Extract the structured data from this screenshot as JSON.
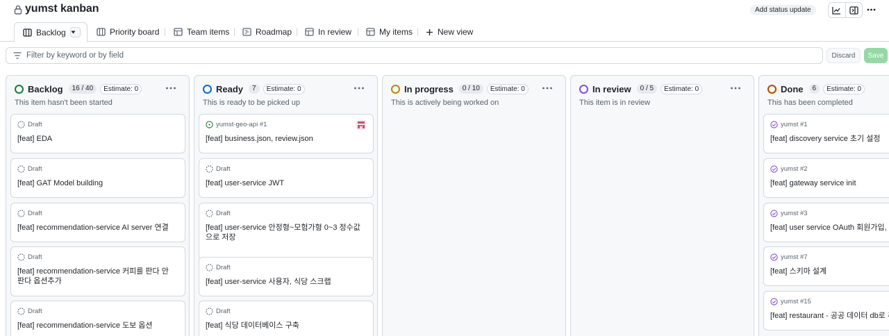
{
  "project": {
    "title": "yumst kanban",
    "status_button": "Add status update"
  },
  "tabs": [
    {
      "label": "Backlog",
      "icon": "board-icon"
    },
    {
      "label": "Priority board",
      "icon": "board-icon"
    },
    {
      "label": "Team items",
      "icon": "table-icon"
    },
    {
      "label": "Roadmap",
      "icon": "roadmap-icon"
    },
    {
      "label": "In review",
      "icon": "table-icon"
    },
    {
      "label": "My items",
      "icon": "table-icon"
    },
    {
      "label": "New view",
      "icon": "plus-icon"
    }
  ],
  "filter": {
    "placeholder": "Filter by keyword or by field",
    "discard": "Discard",
    "save": "Save"
  },
  "colors": {
    "backlog": "#1a7f37",
    "ready": "#0969da",
    "in_progress": "#bf8700",
    "in_review": "#8250df",
    "done": "#bc4c00",
    "done_item": "#8250df",
    "open_item": "#1a7f37"
  },
  "columns": [
    {
      "name": "Backlog",
      "count": "16 / 40",
      "estimate": "Estimate: 0",
      "description": "This item hasn't been started",
      "cards": [
        {
          "meta": "Draft",
          "title": "[feat] EDA"
        },
        {
          "meta": "Draft",
          "title": "[feat] GAT Model building"
        },
        {
          "meta": "Draft",
          "title": "[feat] recommendation-service AI server 연결"
        },
        {
          "meta": "Draft",
          "title": "[feat] recommendation-service 커피를 판다 안판다 옵션추가"
        },
        {
          "meta": "Draft",
          "title": "[feat] recommendation-service 도보 옵션"
        }
      ]
    },
    {
      "name": "Ready",
      "count": "7",
      "estimate": "Estimate: 0",
      "description": "This is ready to be picked up",
      "cards": [
        {
          "meta": "yumst-geo-api #1",
          "title": "[feat] business.json, review.json"
        },
        {
          "meta": "Draft",
          "title": "[feat] user-service JWT"
        },
        {
          "meta": "Draft",
          "title": "[feat] user-service 안정형~모험가형 0~3 정수값으로 저장"
        },
        {
          "meta": "Draft",
          "title": "[feat] user-service 사용자, 식당 스크랩"
        },
        {
          "meta": "Draft",
          "title": "[feat] 식당 데이터베이스 구축"
        }
      ]
    },
    {
      "name": "In progress",
      "count": "0 / 10",
      "estimate": "Estimate: 0",
      "description": "This is actively being worked on",
      "cards": []
    },
    {
      "name": "In review",
      "count": "0 / 5",
      "estimate": "Estimate: 0",
      "description": "This item is in review",
      "cards": []
    },
    {
      "name": "Done",
      "count": "6",
      "estimate": "Estimate: 0",
      "description": "This has been completed",
      "cards": [
        {
          "meta": "yumst #1",
          "title": "[feat] discovery service 초기 설정"
        },
        {
          "meta": "yumst #2",
          "title": "[feat] gateway service init"
        },
        {
          "meta": "yumst #3",
          "title": "[feat] user service OAuth 회원가입, 로그인"
        },
        {
          "meta": "yumst #7",
          "title": "[feat] 스키마 설계"
        },
        {
          "meta": "yumst #15",
          "title": "[feat] restaurant - 공공 데이터 db로 추출"
        }
      ]
    }
  ]
}
